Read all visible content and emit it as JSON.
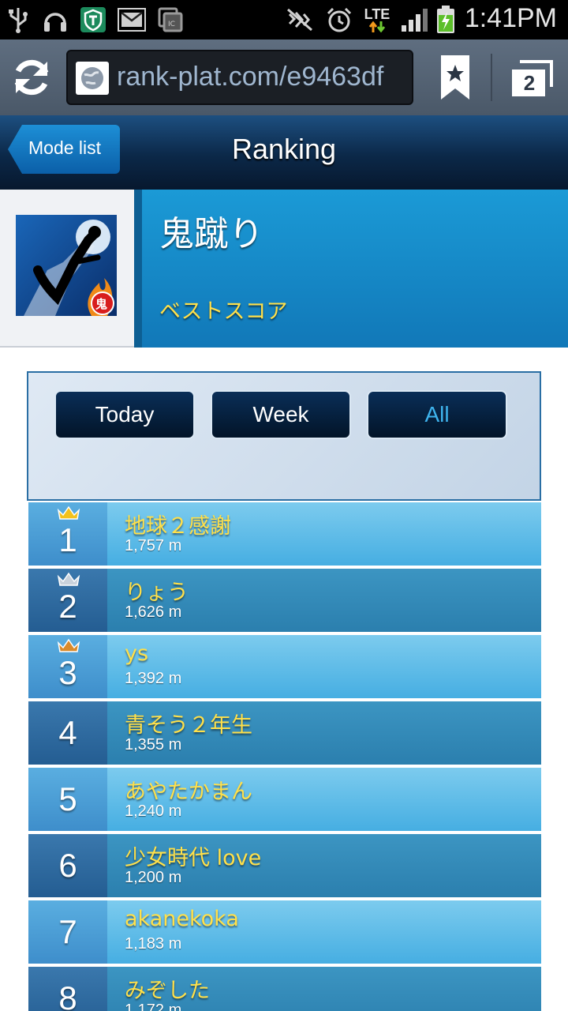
{
  "status_bar": {
    "time": "1:41PM",
    "network": "LTE",
    "icons": [
      "usb-icon",
      "headset-icon",
      "shield-icon",
      "mail-icon",
      "ic-icon",
      "mute-icon",
      "alarm-icon",
      "signal-icon",
      "battery-charging-icon"
    ]
  },
  "browser": {
    "url": "rank-plat.com/e9463df",
    "tab_count": "2"
  },
  "header": {
    "back_label": "Mode list",
    "title": "Ranking"
  },
  "game": {
    "name": "鬼蹴り",
    "score_type": "ベストスコア"
  },
  "periods": [
    {
      "label": "Today",
      "active": false
    },
    {
      "label": "Week",
      "active": false
    },
    {
      "label": "All",
      "active": true
    }
  ],
  "rankings": [
    {
      "rank": "1",
      "name": "地球２感謝",
      "score": "1,757 m",
      "crown": "gold"
    },
    {
      "rank": "2",
      "name": "りょう",
      "score": "1,626 m",
      "crown": "silver"
    },
    {
      "rank": "3",
      "name": "ys",
      "score": "1,392 m",
      "crown": "bronze"
    },
    {
      "rank": "4",
      "name": "青そう２年生",
      "score": "1,355 m"
    },
    {
      "rank": "5",
      "name": "あやたかまん",
      "score": "1,240 m"
    },
    {
      "rank": "6",
      "name": "少女時代 love",
      "score": "1,200 m"
    },
    {
      "rank": "7",
      "name": "akanekoka",
      "score": "1,183 m"
    },
    {
      "rank": "8",
      "name": "みぞした",
      "score": "1,172 m"
    }
  ],
  "colors": {
    "crown_gold": "#f2c21c",
    "crown_silver": "#c9d2dc",
    "crown_bronze": "#d98a2b",
    "name_yellow": "#ffe04a"
  }
}
